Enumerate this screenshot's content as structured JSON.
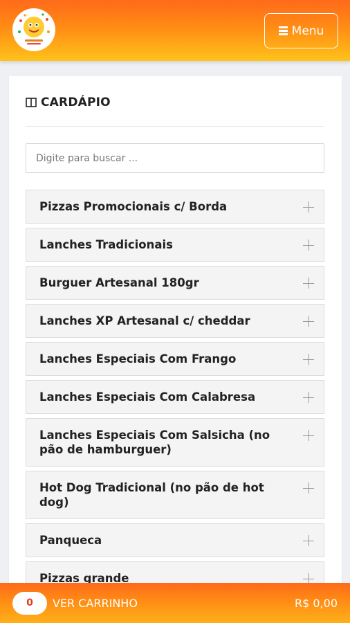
{
  "header": {
    "menu_label": "Menu"
  },
  "colors": {
    "header_gradient_top": "#ff6a1a",
    "header_gradient_bottom": "#ffc21a",
    "footer_gradient": "#ff8c14",
    "badge_text": "#e23b1e"
  },
  "card": {
    "title": "CARDÁPIO",
    "search_placeholder": "Digite para buscar ..."
  },
  "categories": [
    {
      "label": "Pizzas Promocionais c/ Borda"
    },
    {
      "label": "Lanches Tradicionais"
    },
    {
      "label": "Burguer Artesanal 180gr"
    },
    {
      "label": "Lanches XP Artesanal c/ cheddar"
    },
    {
      "label": "Lanches Especiais Com Frango"
    },
    {
      "label": "Lanches Especiais Com Calabresa"
    },
    {
      "label": "Lanches Especiais Com Salsicha (no pão de hamburguer)"
    },
    {
      "label": "Hot Dog Tradicional (no pão de hot dog)"
    },
    {
      "label": "Panqueca"
    },
    {
      "label": "Pizzas grande"
    }
  ],
  "footer": {
    "cart_count": "0",
    "cart_label": "VER CARRINHO",
    "total": "R$ 0,00"
  }
}
